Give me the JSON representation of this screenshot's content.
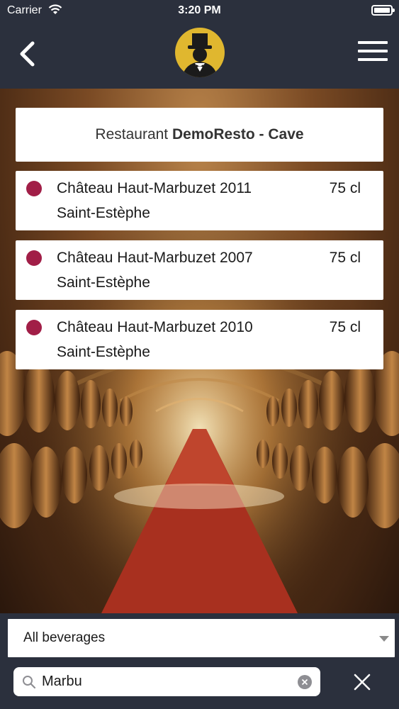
{
  "status_bar": {
    "carrier": "Carrier",
    "time": "3:20 PM"
  },
  "nav": {
    "back_icon": "chevron-left-icon",
    "logo_icon": "top-hat-butler-logo",
    "menu_icon": "hamburger-menu-icon"
  },
  "header": {
    "prefix": "Restaurant",
    "name": "DemoResto - Cave"
  },
  "wines": [
    {
      "name": "Château Haut-Marbuzet 2011",
      "size": "75 cl",
      "region": "Saint-Estèphe",
      "color": "#a11e47"
    },
    {
      "name": "Château Haut-Marbuzet 2007",
      "size": "75 cl",
      "region": "Saint-Estèphe",
      "color": "#a11e47"
    },
    {
      "name": "Château Haut-Marbuzet 2010",
      "size": "75 cl",
      "region": "Saint-Estèphe",
      "color": "#a11e47"
    }
  ],
  "filter": {
    "selected": "All beverages"
  },
  "search": {
    "value": "Marbu"
  },
  "colors": {
    "bar": "#2b303d",
    "wine_dot": "#a11e47",
    "logo_bg": "#e0b72f"
  }
}
